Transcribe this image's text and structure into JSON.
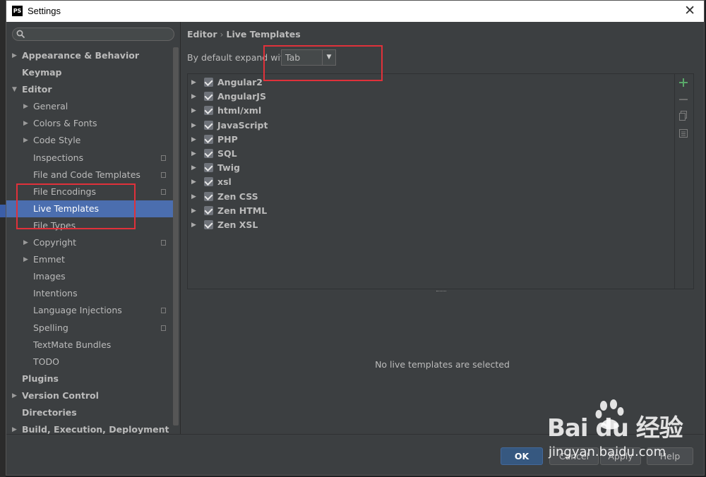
{
  "window": {
    "title": "Settings",
    "app_icon_text": "PS"
  },
  "sidebar": {
    "search_placeholder": "",
    "items": [
      {
        "label": "Appearance & Behavior",
        "bold": true,
        "level": 0,
        "arrow": "▶",
        "name": "sidebar-item-appearance-behavior"
      },
      {
        "label": "Keymap",
        "bold": true,
        "level": 0,
        "arrow": "",
        "name": "sidebar-item-keymap"
      },
      {
        "label": "Editor",
        "bold": true,
        "level": 0,
        "arrow": "▼",
        "name": "sidebar-item-editor"
      },
      {
        "label": "General",
        "level": 1,
        "arrow": "▶",
        "name": "sidebar-item-general"
      },
      {
        "label": "Colors & Fonts",
        "level": 1,
        "arrow": "▶",
        "name": "sidebar-item-colors-fonts"
      },
      {
        "label": "Code Style",
        "level": 1,
        "arrow": "▶",
        "name": "sidebar-item-code-style"
      },
      {
        "label": "Inspections",
        "level": 1,
        "arrow": "",
        "page": true,
        "name": "sidebar-item-inspections"
      },
      {
        "label": "File and Code Templates",
        "level": 1,
        "arrow": "",
        "page": true,
        "name": "sidebar-item-file-code-templates"
      },
      {
        "label": "File Encodings",
        "level": 1,
        "arrow": "",
        "page": true,
        "name": "sidebar-item-file-encodings"
      },
      {
        "label": "Live Templates",
        "level": 1,
        "arrow": "",
        "selected": true,
        "name": "sidebar-item-live-templates"
      },
      {
        "label": "File Types",
        "level": 1,
        "arrow": "",
        "name": "sidebar-item-file-types"
      },
      {
        "label": "Copyright",
        "level": 1,
        "arrow": "▶",
        "page": true,
        "name": "sidebar-item-copyright"
      },
      {
        "label": "Emmet",
        "level": 1,
        "arrow": "▶",
        "name": "sidebar-item-emmet"
      },
      {
        "label": "Images",
        "level": 1,
        "arrow": "",
        "name": "sidebar-item-images"
      },
      {
        "label": "Intentions",
        "level": 1,
        "arrow": "",
        "name": "sidebar-item-intentions"
      },
      {
        "label": "Language Injections",
        "level": 1,
        "arrow": "",
        "page": true,
        "name": "sidebar-item-language-injections"
      },
      {
        "label": "Spelling",
        "level": 1,
        "arrow": "",
        "page": true,
        "name": "sidebar-item-spelling"
      },
      {
        "label": "TextMate Bundles",
        "level": 1,
        "arrow": "",
        "name": "sidebar-item-textmate-bundles"
      },
      {
        "label": "TODO",
        "level": 1,
        "arrow": "",
        "name": "sidebar-item-todo"
      },
      {
        "label": "Plugins",
        "bold": true,
        "level": 0,
        "arrow": "",
        "name": "sidebar-item-plugins"
      },
      {
        "label": "Version Control",
        "bold": true,
        "level": 0,
        "arrow": "▶",
        "name": "sidebar-item-version-control"
      },
      {
        "label": "Directories",
        "bold": true,
        "level": 0,
        "arrow": "",
        "name": "sidebar-item-directories"
      },
      {
        "label": "Build, Execution, Deployment",
        "bold": true,
        "level": 0,
        "arrow": "▶",
        "name": "sidebar-item-build-execution-deployment"
      }
    ]
  },
  "breadcrumb": {
    "parent": "Editor",
    "separator": "›",
    "current": "Live Templates"
  },
  "expand": {
    "label": "By default expand with",
    "value": "Tab"
  },
  "templates": [
    {
      "name": "Angular2",
      "checked": true
    },
    {
      "name": "AngularJS",
      "checked": true
    },
    {
      "name": "html/xml",
      "checked": true
    },
    {
      "name": "JavaScript",
      "checked": true
    },
    {
      "name": "PHP",
      "checked": true
    },
    {
      "name": "SQL",
      "checked": true
    },
    {
      "name": "Twig",
      "checked": true
    },
    {
      "name": "xsl",
      "checked": true
    },
    {
      "name": "Zen CSS",
      "checked": true
    },
    {
      "name": "Zen HTML",
      "checked": true
    },
    {
      "name": "Zen XSL",
      "checked": true
    }
  ],
  "empty_message": "No live templates are selected",
  "footer": {
    "ok": "OK",
    "cancel": "Cancel",
    "apply": "Apply",
    "help": "Help"
  },
  "watermark": {
    "logo": "Bai du 经验",
    "url": "jingyan.baidu.com"
  },
  "colors": {
    "accent_selection": "#4b6eaf",
    "annotation_red": "#e0313a",
    "add_green": "#59a869"
  }
}
